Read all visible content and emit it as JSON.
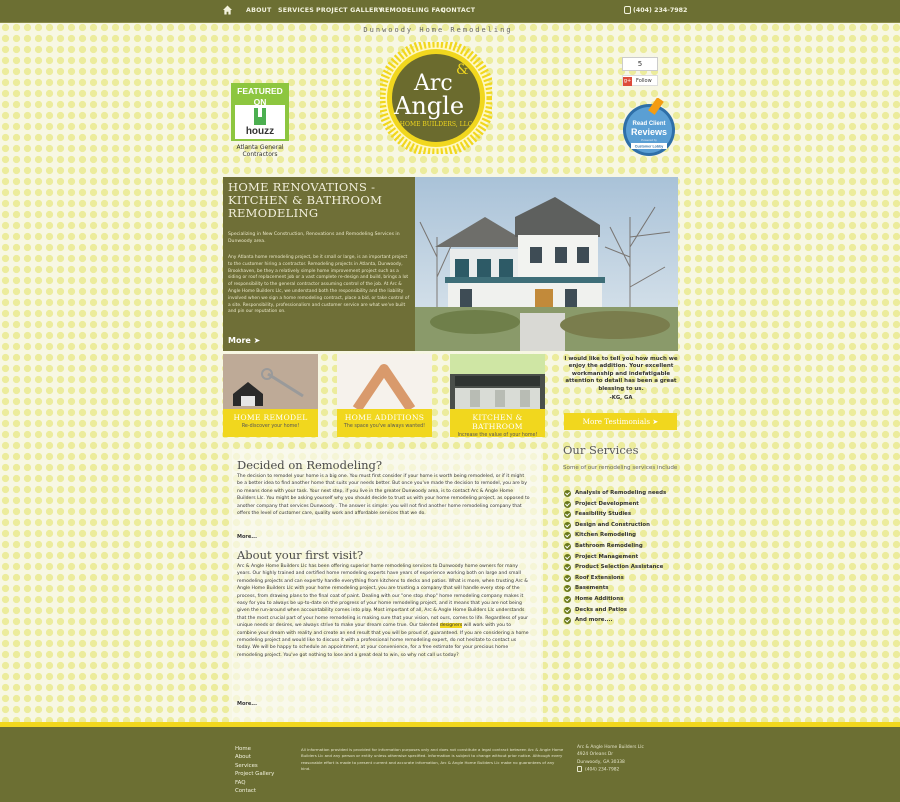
{
  "nav": {
    "home_icon": "home-icon",
    "items": [
      "ABOUT",
      "SERVICES",
      "PROJECT GALLERY",
      "REMODELING FAQ",
      "CONTACT"
    ],
    "phone": "(404) 234-7982"
  },
  "tagline": "Dunwoody Home Remodeling",
  "houzz": {
    "featured": "FEATURED",
    "on": "ON",
    "brand": "houzz",
    "caption_1": "Atlanta General",
    "caption_2": "Contractors"
  },
  "logo": {
    "line1": "Arc",
    "amp": "&",
    "line2": "Angle",
    "sub": "HOME BUILDERS, LLC"
  },
  "social": {
    "fb_count": "5",
    "gplus_label": "Follow",
    "gplus_icon": "g+"
  },
  "reviews_badge": {
    "line1": "Read Client",
    "line2": "Reviews",
    "line3": "Powered by",
    "brand": "Customer Lobby"
  },
  "hero": {
    "title": "HOME RENOVATIONS - KITCHEN & BATHROOM REMODELING",
    "subtitle": "Specializing in New Construction, Renovations and Remodeling Services in Dunwoody area.",
    "body": "Any Atlanta home remodeling project, be it small or large, is an important project to the customer hiring a contractor. Remodeling projects in Atlanta, Dunwoody, Brookhaven, be they a relatively simple home improvement project such as a siding or roof replacement job or a vast complete re-design and build, brings a lot of responsibility to the general contractor assuming control of the job. At Arc & Angle Home Builders Llc, we understand both the responsibility and the liability involved when we sign a home remodeling contract, place a bid, or take control of a site. Responsibility, professionalism and customer service are what we've built and pin our reputation on.",
    "more": "More"
  },
  "tiles": [
    {
      "title": "HOME REMODEL",
      "subtitle": "Re-discover your home!"
    },
    {
      "title": "HOME ADDITIONS",
      "subtitle": "The space you've always wanted!"
    },
    {
      "title": "KITCHEN & BATHROOM",
      "subtitle": "Increase the value of your home!"
    }
  ],
  "testimonial": {
    "quote": "I would like to tell you how much we enjoy the addition. Your excellent workmanship and indefatigable attention to detail has been a great blessing to us.",
    "author": "-KG, GA",
    "more_button": "More Testimonials"
  },
  "main": {
    "section1_title": "Decided on Remodeling?",
    "section1_text": "The decision to remodel your home is a big one. You must first consider if your home is worth being remodeled, or if it might be a better idea to find another home that suits your needs better. But once you've made the decision to remodel, you are by no means done with your task. Your next step, if you live in the greater Dunwoody area, is to contact Arc & Angle Home Builders Llc. You might be asking yourself why you should decide to trust us with your home remodeling project, as opposed to another company that services Dunwoody . The answer is simple: you will not find another home remodeling company that offers the level of customer care, quality work and affordable services that we do.",
    "section1_more": "More...",
    "section2_title": "About your first visit?",
    "section2_text_a": "Arc & Angle Home Builders Llc has been offering superior home remodeling services to Dunwoody home owners for many years. Our highly trained and certified home remodeling experts have years of experience working both on large and small remodeling projects and can expertly handle everything from kitchens to decks and patios. What is more, when trusting Arc & Angle Home Builders Llc with your home remodeling project, you are trusting a company that will handle every step of the process, from drawing plans to the final coat of paint. Dealing with our \"one stop shop\" home remodeling company makes it easy for you to always be up-to-date on the progress of your home remodeling project, and it means that you are not being given the run-around when accountability comes into play. Most important of all, Arc & Angle Home Builders Llc understands that the most crucial part of your home remodeling is making sure that your vision, not ours, comes to life. Regardless of your unique needs or desires, we always strive to make your dream come true. Our talented ",
    "section2_highlight": "designers",
    "section2_text_b": " will work with you to combine your dream with reality and create an end result that you will be proud of, guaranteed. If you are considering a home remodeling project and would like to discuss it with a professional home remodeling expert, do not hesitate to contact us today. We will be happy to schedule an appointment, at your convenience, for a free estimate for your precious home remodeling project. You've got nothing to lose and a great deal to win, so why not call us today?",
    "section2_more": "More..."
  },
  "services": {
    "title": "Our Services",
    "intro": "Some of our remodeling services include",
    "items": [
      "Analysis of Remodeling needs",
      "Project Development",
      "Feasibility Studies",
      "Design and Construction",
      "Kitchen Remodeling",
      "Bathroom Remodeling",
      "Project Management",
      "Product Selection Assistance",
      "Roof Extensions",
      "Basements",
      "Home Additions",
      "Decks and Patios",
      "And more...."
    ]
  },
  "footer": {
    "links": [
      "Home",
      "About",
      "Services",
      "Project Gallery",
      "FAQ",
      "Contact"
    ],
    "disclaimer": "All information provided is provided for information purposes only and does not constitute a legal contract between Arc & Angle Home Builders Llc and any person or entity unless otherwise specified. Information is subject to change without prior notice. Although every reasonable effort is made to present current and accurate information, Arc & Angle Home Builders Llc make no guarantees of any kind.",
    "company": "Arc & Angle Home Builders Llc",
    "street": "4924 Orleans Dr",
    "city": "Dunwoody, GA 30338",
    "phone": "(404) 234-7982"
  },
  "colors": {
    "olive": "#6c6f33",
    "yellow": "#f1d71e",
    "logo_olive": "#6b6b2e"
  }
}
